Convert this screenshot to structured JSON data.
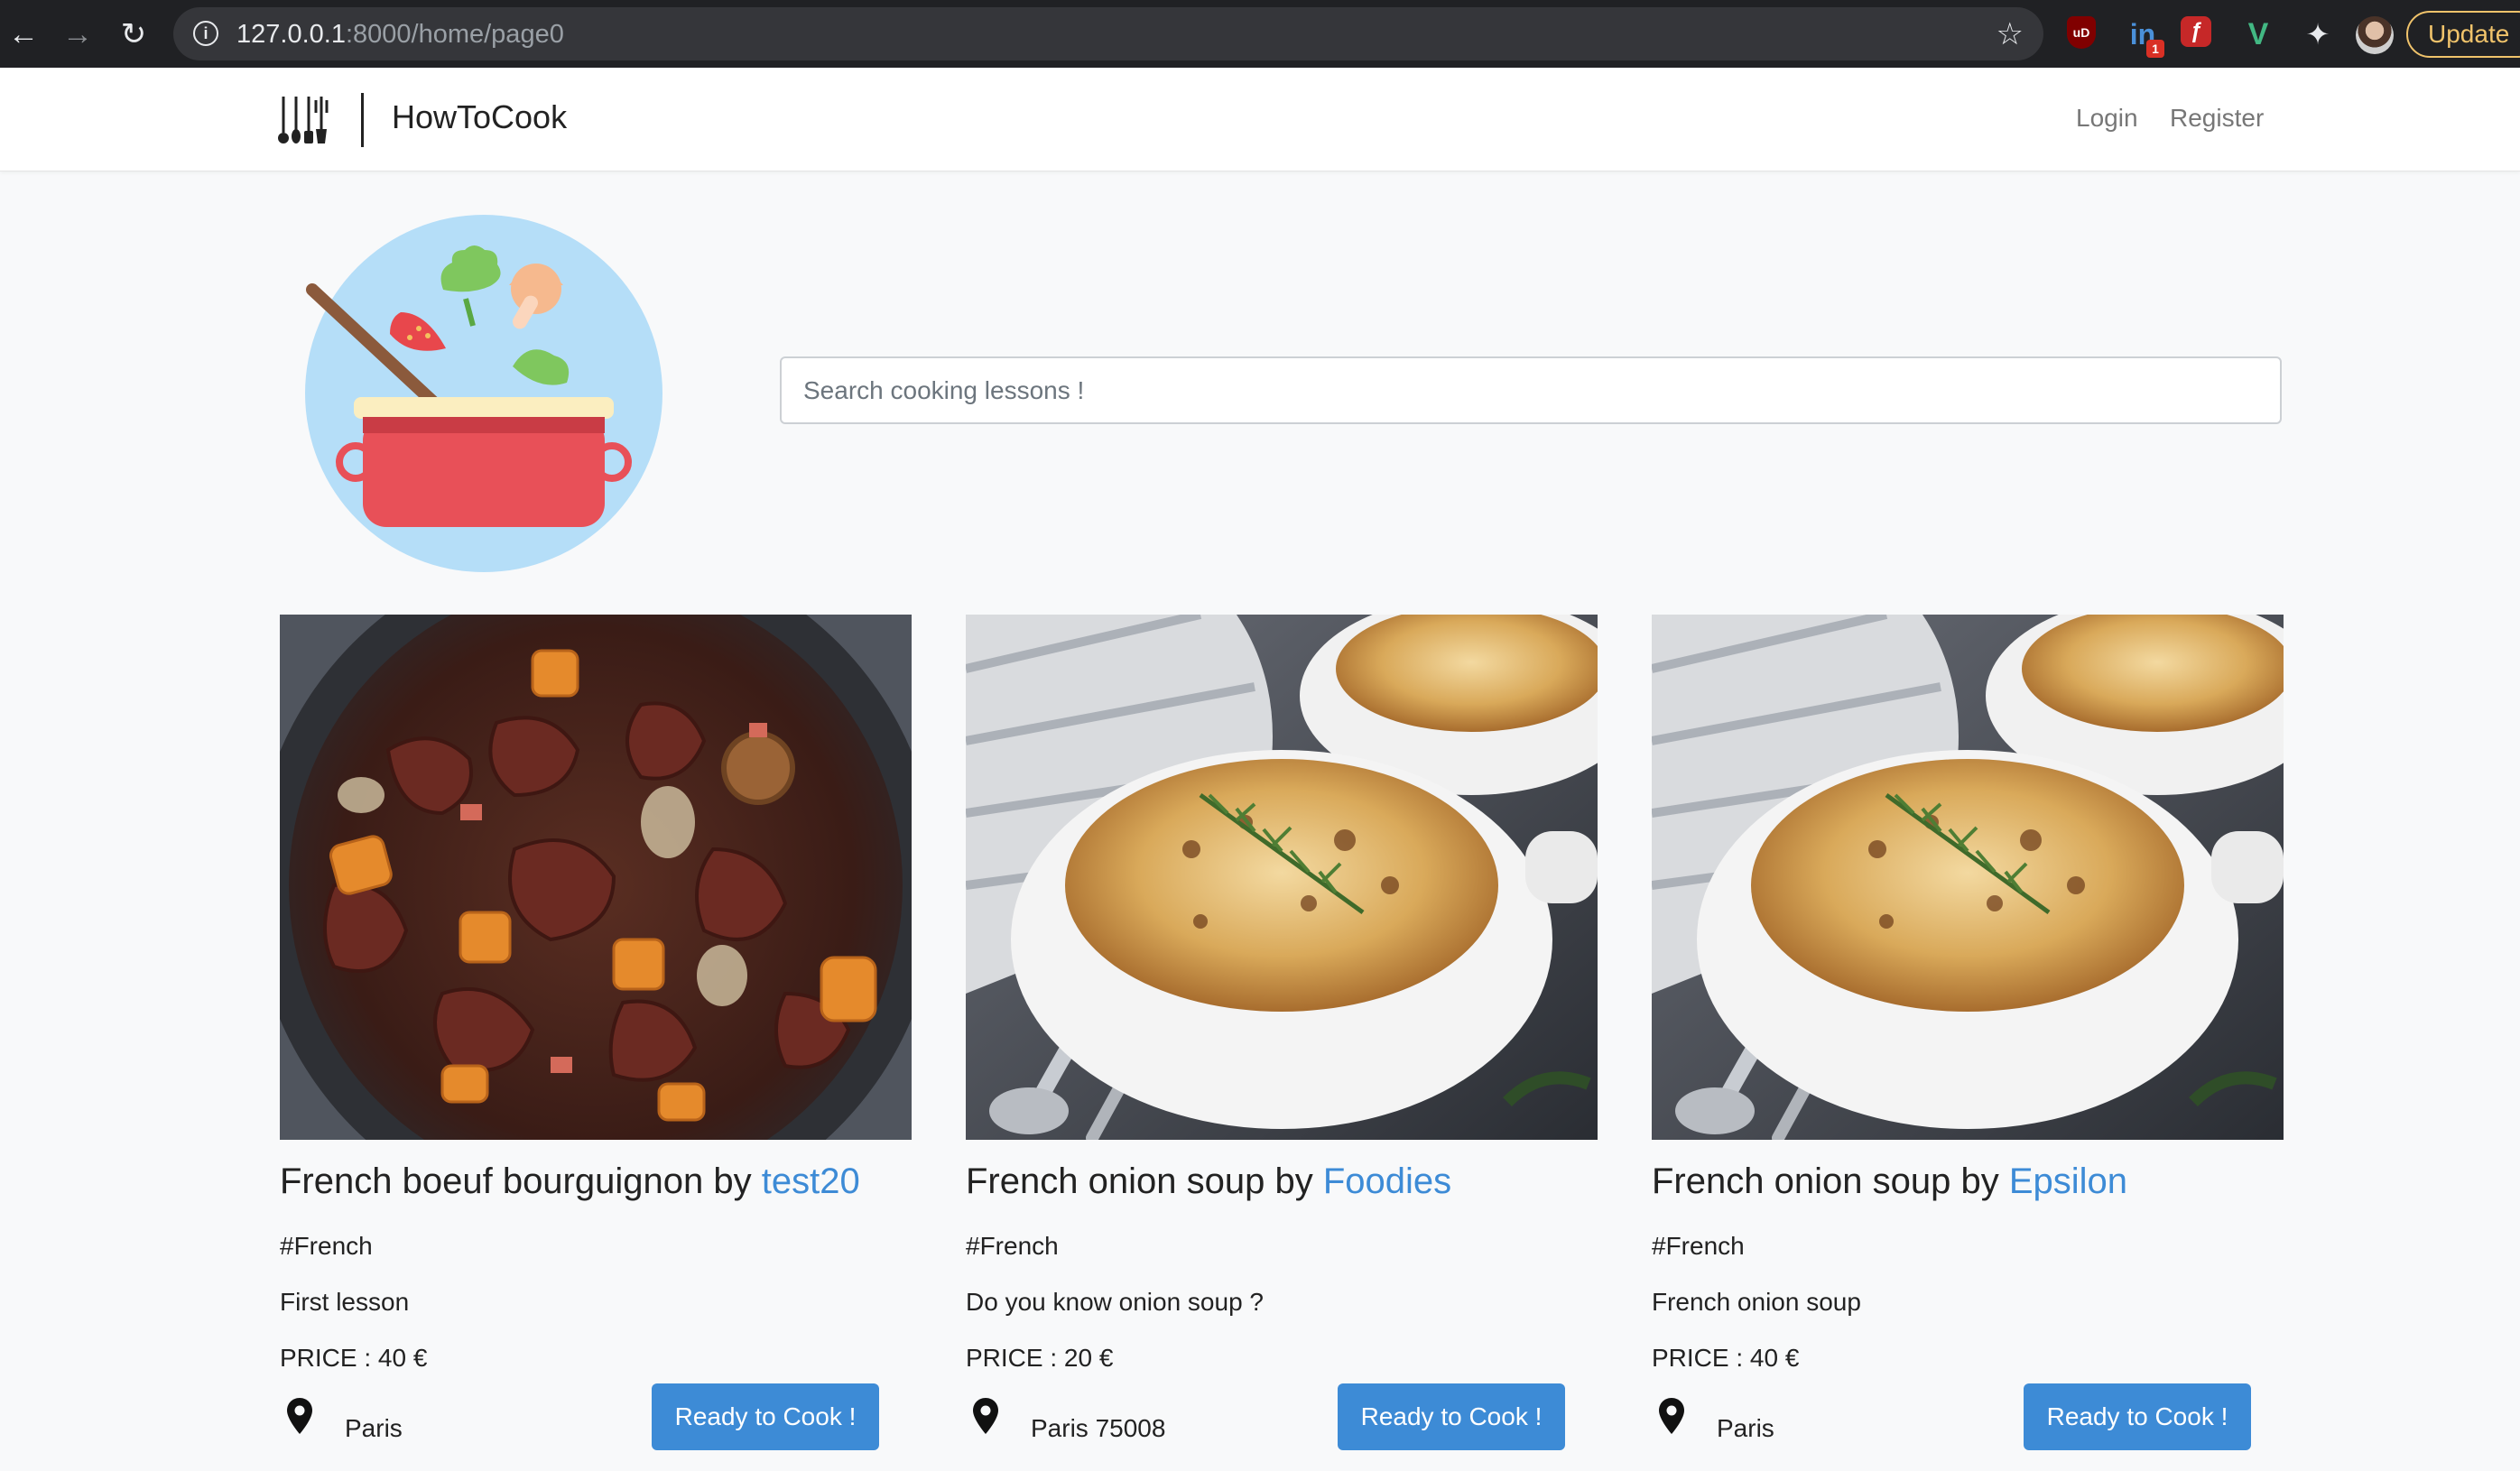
{
  "browser": {
    "url_host": "127.0.0.1",
    "url_rest": ":8000/home/page0",
    "update_label": "Update",
    "ext_badge_count": "1"
  },
  "site": {
    "brand": "HowToCook",
    "nav": {
      "login": "Login",
      "register": "Register"
    }
  },
  "search": {
    "placeholder": "Search cooking lessons !"
  },
  "cards": [
    {
      "dish": "French boeuf bourguignon by ",
      "author": "test20",
      "tag": "#French",
      "description": "First lesson",
      "price": "PRICE : 40 €",
      "city": "Paris",
      "cta": "Ready to Cook !",
      "image": "boeuf-bourguignon"
    },
    {
      "dish": "French onion soup by ",
      "author": "Foodies",
      "tag": "#French",
      "description": "Do you know onion soup ?",
      "price": "PRICE : 20 €",
      "city": "Paris 75008",
      "cta": "Ready to Cook !",
      "image": "onion-soup"
    },
    {
      "dish": "French onion soup by ",
      "author": "Epsilon",
      "tag": "#French",
      "description": "French onion soup",
      "price": "PRICE : 40 €",
      "city": "Paris",
      "cta": "Ready to Cook !",
      "image": "onion-soup"
    }
  ],
  "colors": {
    "accent": "#3d8bd6",
    "page_bg": "#f8f9fa"
  }
}
